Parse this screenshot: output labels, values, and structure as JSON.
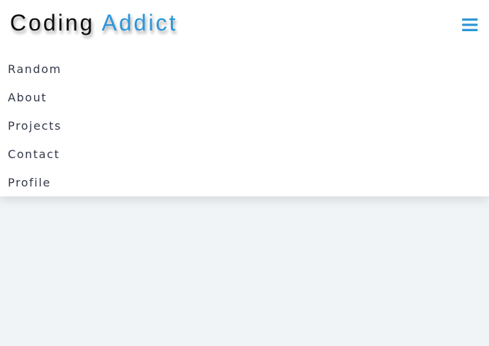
{
  "brand": {
    "part1": "Coding",
    "part2": "Addict",
    "accent_color": "#2c96d8"
  },
  "menu_toggle": {
    "icon": "hamburger-menu-icon"
  },
  "nav": {
    "links": [
      {
        "label": "Random"
      },
      {
        "label": "About"
      },
      {
        "label": "Projects"
      },
      {
        "label": "Contact"
      },
      {
        "label": "Profile"
      }
    ]
  },
  "colors": {
    "page_background": "#f1f4f7",
    "navbar_background": "#ffffff",
    "link_text": "#33394a"
  }
}
